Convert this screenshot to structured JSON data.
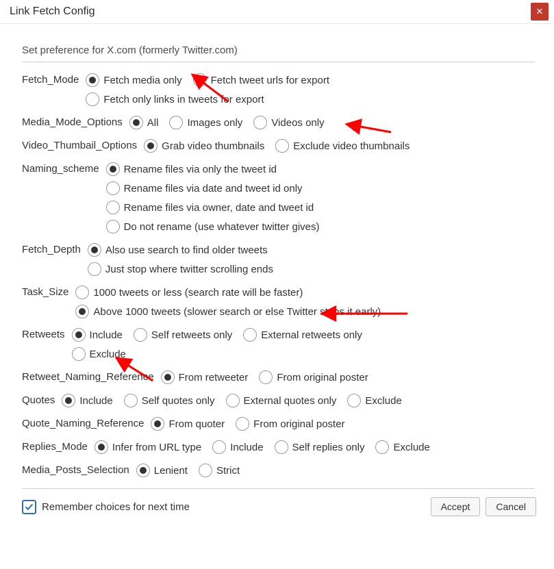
{
  "window": {
    "title": "Link Fetch Config",
    "subtitle": "Set preference for X.com (formerly Twitter.com)"
  },
  "groups": [
    {
      "id": "fetch-mode",
      "label": "Fetch_Mode",
      "rows": [
        [
          {
            "id": "fetch-media-only",
            "label": "Fetch media only",
            "selected": true
          },
          {
            "id": "fetch-tweet-urls",
            "label": "Fetch tweet urls for export",
            "selected": false
          }
        ],
        [
          {
            "id": "fetch-only-links",
            "label": "Fetch only links in tweets for export",
            "selected": false
          }
        ]
      ]
    },
    {
      "id": "media-mode-options",
      "label": "Media_Mode_Options",
      "rows": [
        [
          {
            "id": "all",
            "label": "All",
            "selected": true
          },
          {
            "id": "images-only",
            "label": "Images only",
            "selected": false
          },
          {
            "id": "videos-only",
            "label": "Videos only",
            "selected": false
          }
        ]
      ]
    },
    {
      "id": "video-thumbnail-options",
      "label": "Video_Thumbail_Options",
      "rows": [
        [
          {
            "id": "grab-video-thumbs",
            "label": "Grab video thumbnails",
            "selected": true
          },
          {
            "id": "exclude-video-thumbs",
            "label": "Exclude video thumbnails",
            "selected": false
          }
        ]
      ]
    },
    {
      "id": "naming-scheme",
      "label": "Naming_scheme",
      "rows": [
        [
          {
            "id": "rename-tweet-id",
            "label": "Rename files via only the tweet id",
            "selected": true
          }
        ],
        [
          {
            "id": "rename-date-id",
            "label": "Rename files via date and tweet id only",
            "selected": false
          }
        ],
        [
          {
            "id": "rename-owner-date-id",
            "label": "Rename files via owner, date and tweet id",
            "selected": false
          }
        ],
        [
          {
            "id": "do-not-rename",
            "label": "Do not rename (use whatever twitter gives)",
            "selected": false
          }
        ]
      ]
    },
    {
      "id": "fetch-depth",
      "label": "Fetch_Depth",
      "rows": [
        [
          {
            "id": "use-search",
            "label": "Also use search to find older tweets",
            "selected": true
          }
        ],
        [
          {
            "id": "stop-scroll",
            "label": "Just stop where twitter scrolling ends",
            "selected": false
          }
        ]
      ]
    },
    {
      "id": "task-size",
      "label": "Task_Size",
      "rows": [
        [
          {
            "id": "under-1000",
            "label": "1000 tweets or less (search rate will be faster)",
            "selected": false
          }
        ],
        [
          {
            "id": "above-1000",
            "label": "Above 1000 tweets (slower search or else Twitter stops it early)",
            "selected": true
          }
        ]
      ]
    },
    {
      "id": "retweets",
      "label": "Retweets",
      "rows": [
        [
          {
            "id": "include",
            "label": "Include",
            "selected": true
          },
          {
            "id": "self-retweets",
            "label": "Self retweets only",
            "selected": false
          },
          {
            "id": "external-retweets",
            "label": "External retweets only",
            "selected": false
          }
        ],
        [
          {
            "id": "exclude",
            "label": "Exclude",
            "selected": false
          }
        ]
      ]
    },
    {
      "id": "retweet-naming-reference",
      "label": "Retweet_Naming_Reference",
      "rows": [
        [
          {
            "id": "from-retweeter",
            "label": "From retweeter",
            "selected": true
          },
          {
            "id": "from-original-poster",
            "label": "From original poster",
            "selected": false
          }
        ]
      ]
    },
    {
      "id": "quotes",
      "label": "Quotes",
      "rows": [
        [
          {
            "id": "q-include",
            "label": "Include",
            "selected": true
          },
          {
            "id": "q-self",
            "label": "Self quotes only",
            "selected": false
          },
          {
            "id": "q-external",
            "label": "External quotes only",
            "selected": false
          },
          {
            "id": "q-exclude",
            "label": "Exclude",
            "selected": false
          }
        ]
      ]
    },
    {
      "id": "quote-naming-reference",
      "label": "Quote_Naming_Reference",
      "rows": [
        [
          {
            "id": "from-quoter",
            "label": "From quoter",
            "selected": true
          },
          {
            "id": "q-from-original",
            "label": "From original poster",
            "selected": false
          }
        ]
      ]
    },
    {
      "id": "replies-mode",
      "label": "Replies_Mode",
      "rows": [
        [
          {
            "id": "infer",
            "label": "Infer from URL type",
            "selected": true
          },
          {
            "id": "r-include",
            "label": "Include",
            "selected": false
          },
          {
            "id": "r-self",
            "label": "Self replies only",
            "selected": false
          },
          {
            "id": "r-exclude",
            "label": "Exclude",
            "selected": false
          }
        ]
      ]
    },
    {
      "id": "media-posts-selection",
      "label": "Media_Posts_Selection",
      "rows": [
        [
          {
            "id": "lenient",
            "label": "Lenient",
            "selected": true
          },
          {
            "id": "strict",
            "label": "Strict",
            "selected": false
          }
        ]
      ]
    }
  ],
  "footer": {
    "remember_label": "Remember choices for next time",
    "remember_checked": true,
    "accept_label": "Accept",
    "cancel_label": "Cancel"
  }
}
